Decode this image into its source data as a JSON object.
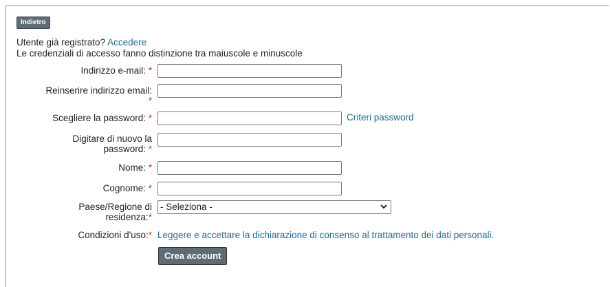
{
  "header": {
    "back_label": "Indietro"
  },
  "intro": {
    "registered_text": "Utente già registrato?",
    "login_link": "Accedere",
    "case_note": "Le credenziali di accesso fanno distinzione tra maiuscole e minuscole"
  },
  "form": {
    "email_label": "Indirizzo e-mail:",
    "email_confirm_label": "Reinserire indirizzo email:",
    "password_label": "Scegliere la password:",
    "password_criteria_link": "Criteri password",
    "password_confirm_label_1": "Digitare di nuovo la",
    "password_confirm_label_2": "password:",
    "first_name_label": "Nome:",
    "last_name_label": "Cognome:",
    "country_label_1": "Paese/Regione di",
    "country_label_2": "residenza:",
    "country_selected": "- Seleziona -",
    "terms_label": "Condizioni d'uso:",
    "terms_link": "Leggere e accettare la dichiarazione di consenso al trattamento dei dati personali.",
    "required_mark": "*",
    "submit_label": "Crea account"
  },
  "colors": {
    "accent_link": "#1f6a94",
    "required": "#d0342c",
    "button_bg": "#5f6b75"
  }
}
